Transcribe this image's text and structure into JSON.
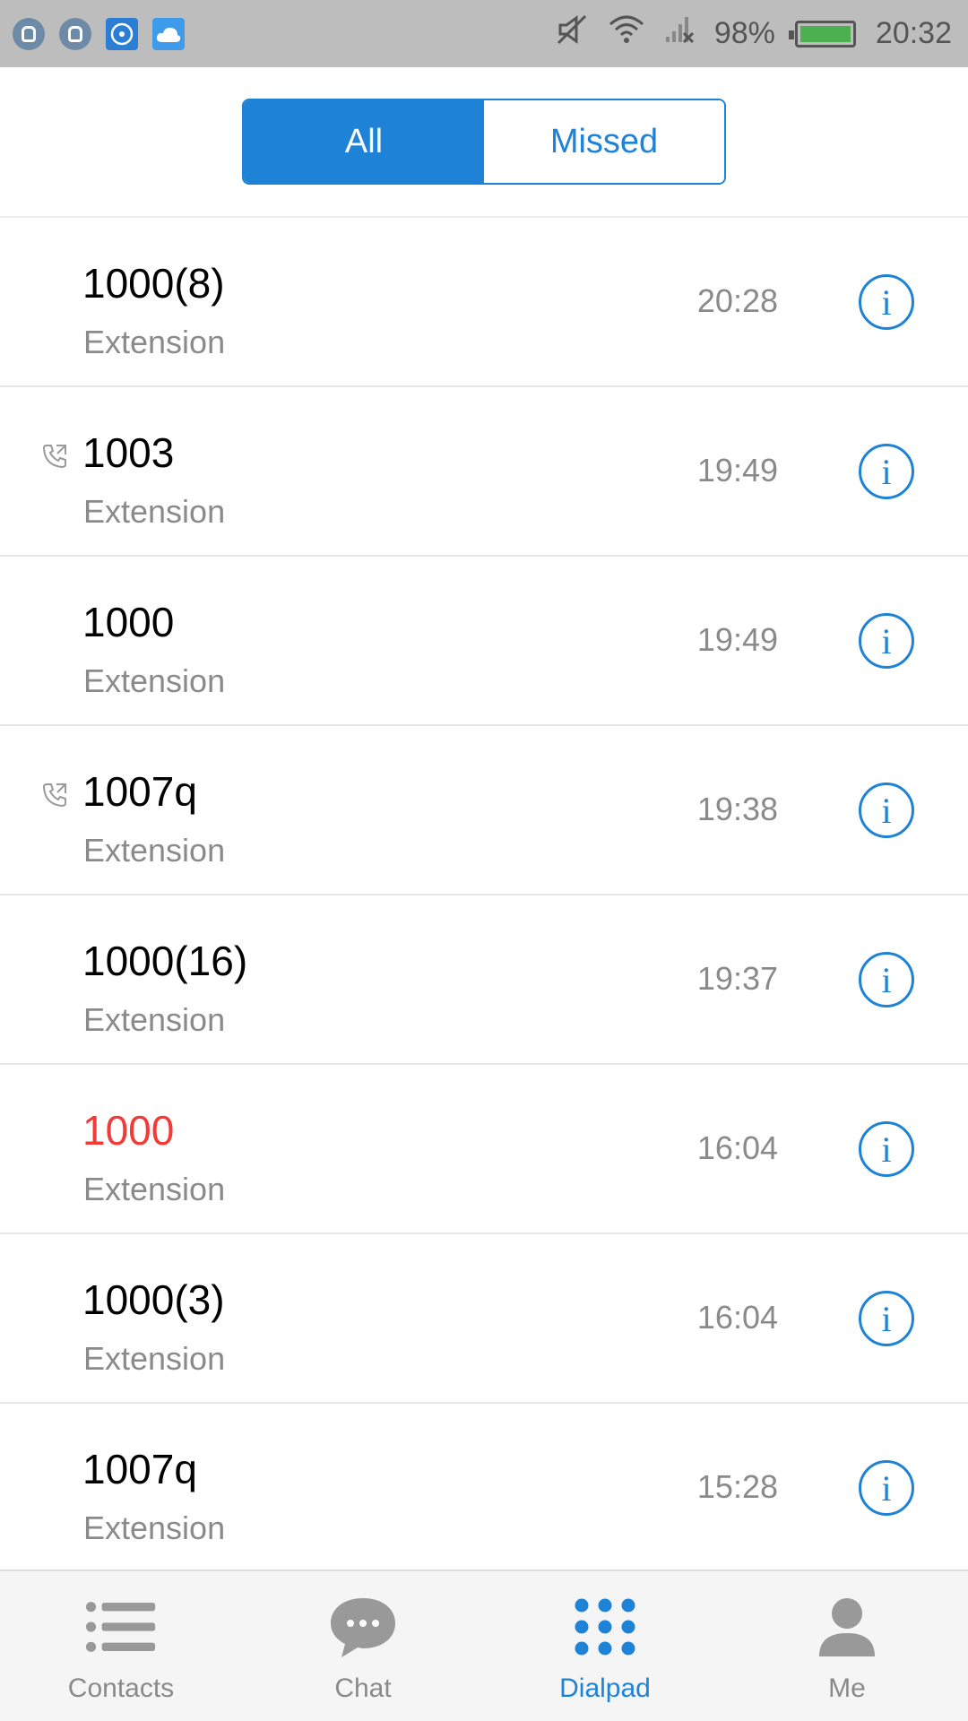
{
  "status_bar": {
    "battery_percent": "98%",
    "time": "20:32",
    "icons": [
      "app-notification-icon",
      "app-notification-icon",
      "app-store-icon",
      "weather-icon",
      "mute-icon",
      "wifi-icon",
      "no-signal-icon",
      "battery-icon"
    ]
  },
  "segment": {
    "all_label": "All",
    "missed_label": "Missed",
    "selected": "All"
  },
  "calls": [
    {
      "name": "1000(8)",
      "sub": "Extension",
      "time": "20:28",
      "missed": false,
      "outgoing": false
    },
    {
      "name": "1003",
      "sub": "Extension",
      "time": "19:49",
      "missed": false,
      "outgoing": true
    },
    {
      "name": "1000",
      "sub": "Extension",
      "time": "19:49",
      "missed": false,
      "outgoing": false
    },
    {
      "name": "1007q",
      "sub": "Extension",
      "time": "19:38",
      "missed": false,
      "outgoing": true
    },
    {
      "name": "1000(16)",
      "sub": "Extension",
      "time": "19:37",
      "missed": false,
      "outgoing": false
    },
    {
      "name": "1000",
      "sub": "Extension",
      "time": "16:04",
      "missed": true,
      "outgoing": false
    },
    {
      "name": "1000(3)",
      "sub": "Extension",
      "time": "16:04",
      "missed": false,
      "outgoing": false
    },
    {
      "name": "1007q",
      "sub": "Extension",
      "time": "15:28",
      "missed": false,
      "outgoing": false
    }
  ],
  "info_glyph": "i",
  "bottom_nav": [
    {
      "label": "Contacts",
      "icon": "contacts-list-icon",
      "active": false
    },
    {
      "label": "Chat",
      "icon": "chat-bubble-icon",
      "active": false
    },
    {
      "label": "Dialpad",
      "icon": "dialpad-icon",
      "active": true
    },
    {
      "label": "Me",
      "icon": "person-icon",
      "active": false
    }
  ],
  "colors": {
    "accent": "#1e82d6",
    "missed": "#f23a36",
    "secondary_text": "#8a8a8a",
    "status_bar": "#bdbdbd"
  }
}
